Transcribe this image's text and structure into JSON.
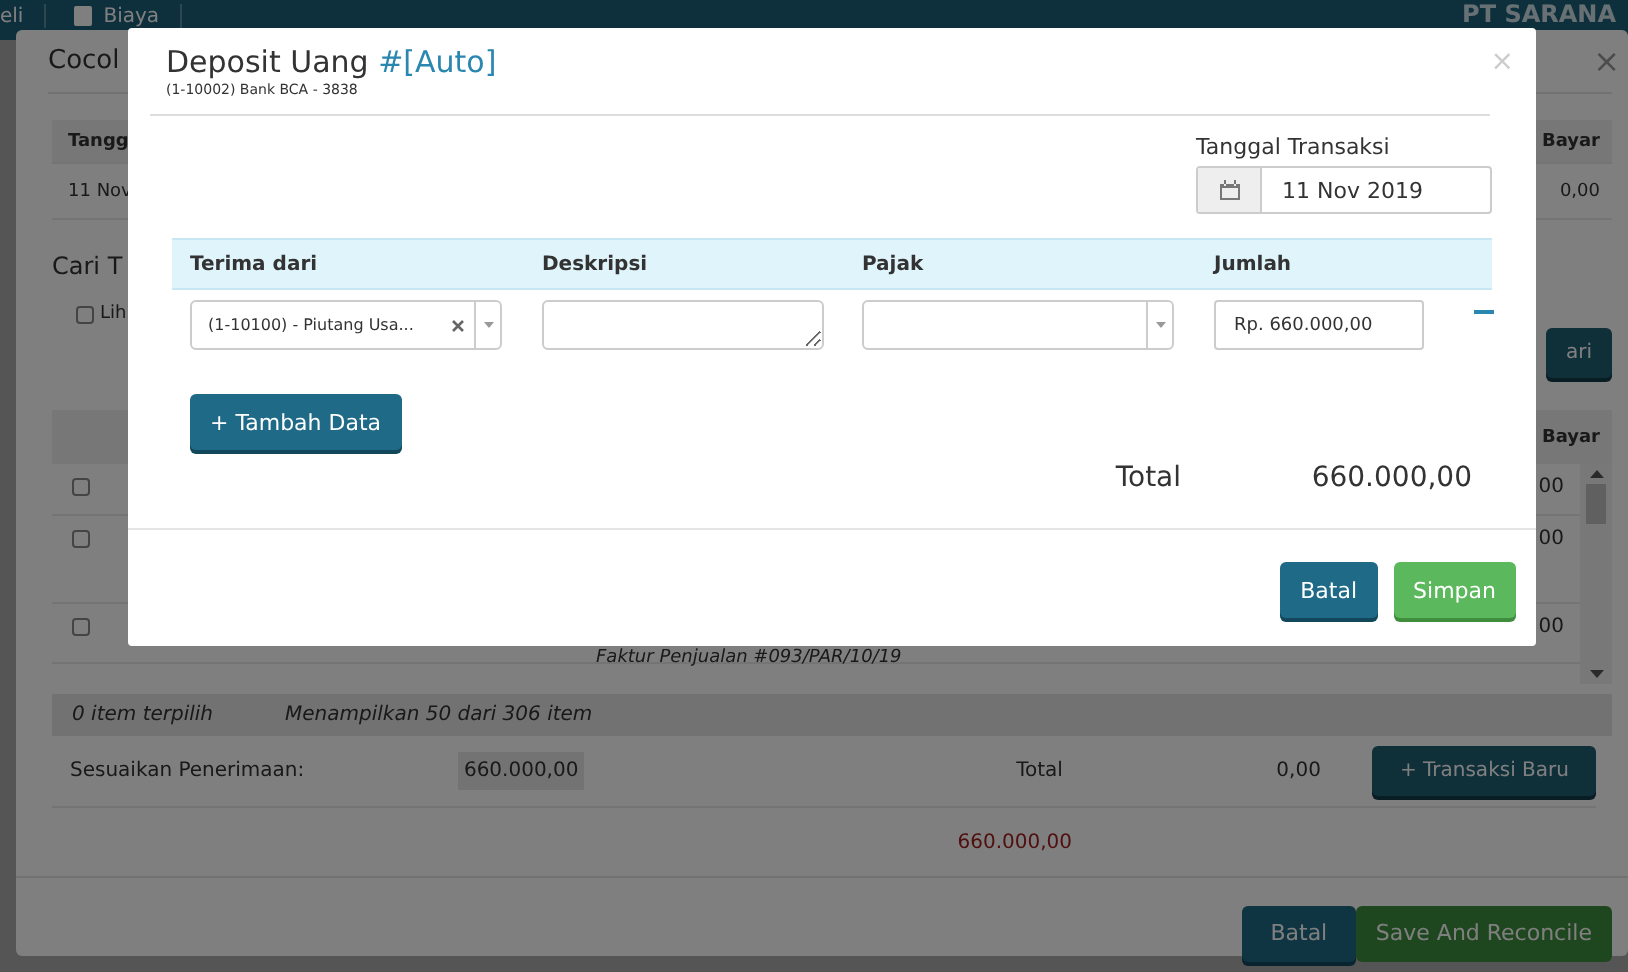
{
  "navbar": {
    "items": [
      {
        "label": "eli",
        "icon": false
      },
      {
        "label": "Biaya",
        "icon": true
      }
    ],
    "company": "PT SARANA"
  },
  "background_dialog": {
    "title": "Cocol",
    "close": "×",
    "top_table": {
      "columns": [
        "Tangg",
        "Bayar"
      ],
      "row": [
        "11 Nov",
        "0,00"
      ]
    },
    "search_label": "Cari T",
    "show_option": {
      "label": "Lih",
      "checked": false
    },
    "search_button": "ari",
    "list": {
      "column": "Bayar",
      "rows": [
        {
          "checked": false,
          "amount": "00"
        },
        {
          "checked": false,
          "amount": "00"
        },
        {
          "checked": false,
          "amount": "00",
          "note": "Faktur Penjualan #093/PAR/10/19"
        }
      ]
    },
    "status": [
      "0 item terpilih",
      "Menampilkan 50 dari 306 item"
    ],
    "adjust_label": "Sesuaikan Penerimaan:",
    "adjust_value": "660.000,00",
    "total_label": "Total",
    "total_value": "0,00",
    "new_button": "+ Transaksi Baru",
    "difference": "660.000,00",
    "buttons": [
      {
        "label": "Batal",
        "kind": "primary",
        "disabled": false
      },
      {
        "label": "Save And Reconcile",
        "kind": "success",
        "disabled": true
      }
    ]
  },
  "dialog": {
    "title": "Deposit Uang",
    "number": "#[Auto]",
    "subtitle": "(1-10002) Bank BCA - 3838",
    "close": "×",
    "date_label": "Tanggal Transaksi",
    "date": "11 Nov 2019",
    "columns": [
      "Terima dari",
      "Deskripsi",
      "Pajak",
      "Jumlah"
    ],
    "lines": [
      {
        "account": "(1-10100) - Piutang Usa...",
        "amount": "Rp. 660.000,00"
      }
    ],
    "add_button": "+ Tambah Data",
    "total_label": "Total",
    "total": "660.000,00",
    "buttons": [
      {
        "label": "Batal",
        "kind": "primary",
        "disabled": false
      },
      {
        "label": "Simpan",
        "kind": "success",
        "disabled": false
      }
    ]
  }
}
